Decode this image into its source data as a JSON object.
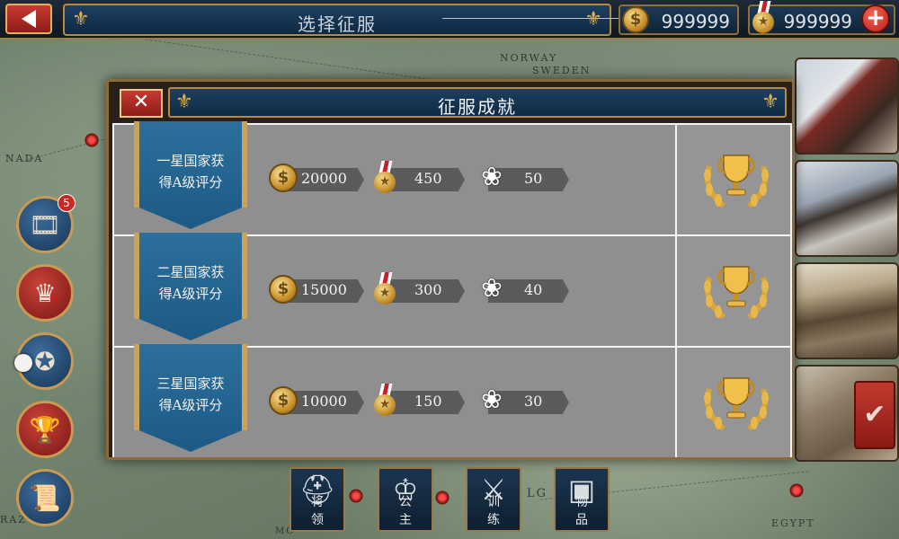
{
  "header": {
    "title": "选择征服",
    "gold": "999999",
    "medals": "999999",
    "plus_label": "+"
  },
  "icons": {
    "back": "back-arrow-icon",
    "gold": "coin-icon",
    "medal": "medal-icon",
    "add": "plus-icon",
    "close": "close-icon",
    "flower": "flower-icon",
    "trophy": "trophy-laurel-icon",
    "confirm": "checkmark-icon"
  },
  "map_labels": [
    "NORWAY",
    "SWEDEN",
    "NADA",
    "EGYPT",
    "LG",
    "RAZ",
    "MO"
  ],
  "side_menu": {
    "video_badge": "5"
  },
  "bottom_menu": [
    {
      "label": "将领"
    },
    {
      "label": "公主"
    },
    {
      "label": "训练"
    },
    {
      "label": "物品"
    }
  ],
  "modal": {
    "title": "征服成就",
    "close_label": "✕",
    "rows": [
      {
        "banner": "一星国家获得A级评分",
        "gold": "20000",
        "medal": "450",
        "flower": "50"
      },
      {
        "banner": "二星国家获得A级评分",
        "gold": "15000",
        "medal": "300",
        "flower": "40"
      },
      {
        "banner": "三星国家获得A级评分",
        "gold": "10000",
        "medal": "150",
        "flower": "30"
      }
    ]
  },
  "colors": {
    "accent_gold": "#c89a55",
    "banner_blue": "#2c6f9c",
    "button_red": "#c83a32",
    "plate_navy": "#1d4062"
  }
}
